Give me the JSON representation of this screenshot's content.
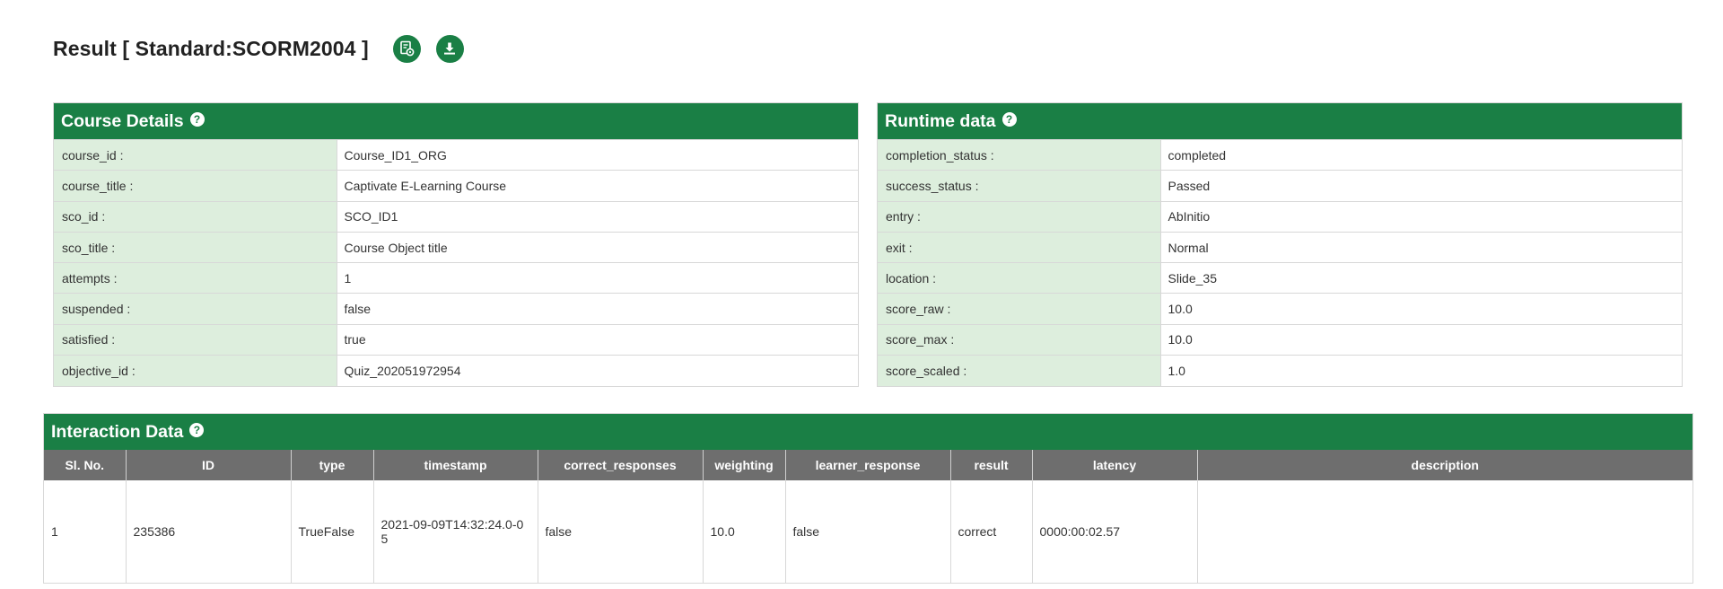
{
  "header": {
    "title": "Result [ Standard:SCORM2004 ]",
    "icons": [
      "report-settings-icon",
      "download-icon"
    ]
  },
  "course_details": {
    "title": "Course Details",
    "rows": [
      {
        "key": "course_id :",
        "value": "Course_ID1_ORG"
      },
      {
        "key": "course_title :",
        "value": "Captivate E-Learning Course"
      },
      {
        "key": "sco_id :",
        "value": "SCO_ID1"
      },
      {
        "key": "sco_title :",
        "value": "Course Object title"
      },
      {
        "key": "attempts :",
        "value": "1"
      },
      {
        "key": "suspended :",
        "value": "false"
      },
      {
        "key": "satisfied :",
        "value": "true"
      },
      {
        "key": "objective_id :",
        "value": "Quiz_202051972954"
      }
    ]
  },
  "runtime_data": {
    "title": "Runtime data",
    "rows": [
      {
        "key": "completion_status :",
        "value": "completed"
      },
      {
        "key": "success_status :",
        "value": "Passed"
      },
      {
        "key": "entry :",
        "value": "AbInitio"
      },
      {
        "key": "exit :",
        "value": "Normal"
      },
      {
        "key": "location :",
        "value": "Slide_35"
      },
      {
        "key": "score_raw :",
        "value": "10.0"
      },
      {
        "key": "score_max :",
        "value": "10.0"
      },
      {
        "key": "score_scaled :",
        "value": "1.0"
      }
    ]
  },
  "interaction_data": {
    "title": "Interaction Data",
    "columns": [
      "Sl. No.",
      "ID",
      "type",
      "timestamp",
      "correct_responses",
      "weighting",
      "learner_response",
      "result",
      "latency",
      "description"
    ],
    "rows": [
      [
        "1",
        "235386",
        "TrueFalse",
        "2021-09-09T14:32:24.0-05",
        "false",
        "10.0",
        "false",
        "correct",
        "0000:00:02.57",
        ""
      ]
    ]
  },
  "colors": {
    "brand_green": "#1a7f45",
    "key_cell_bg": "#ddeedd",
    "table_header_bg": "#6e6e6e"
  }
}
